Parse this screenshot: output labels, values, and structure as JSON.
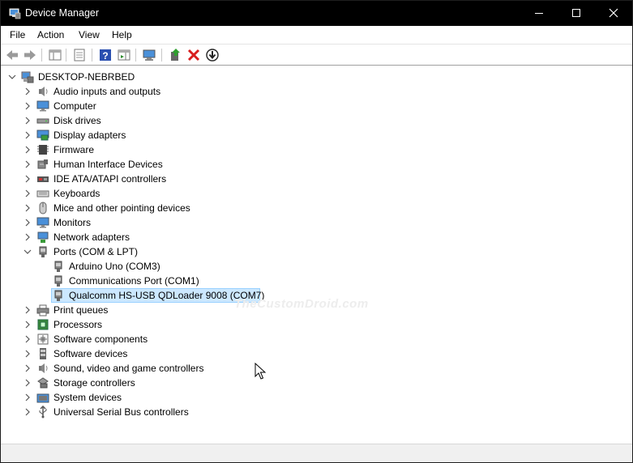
{
  "window": {
    "title": "Device Manager"
  },
  "menu": {
    "file": "File",
    "action": "Action",
    "view": "View",
    "help": "Help"
  },
  "tree": {
    "root": "DESKTOP-NEBRBED",
    "categories": [
      {
        "label": "Audio inputs and outputs",
        "icon": "speaker-icon"
      },
      {
        "label": "Computer",
        "icon": "computer-icon"
      },
      {
        "label": "Disk drives",
        "icon": "disk-drive-icon"
      },
      {
        "label": "Display adapters",
        "icon": "display-adapter-icon"
      },
      {
        "label": "Firmware",
        "icon": "firmware-chip-icon"
      },
      {
        "label": "Human Interface Devices",
        "icon": "hid-icon"
      },
      {
        "label": "IDE ATA/ATAPI controllers",
        "icon": "ide-controller-icon"
      },
      {
        "label": "Keyboards",
        "icon": "keyboard-icon"
      },
      {
        "label": "Mice and other pointing devices",
        "icon": "mouse-icon"
      },
      {
        "label": "Monitors",
        "icon": "monitor-icon"
      },
      {
        "label": "Network adapters",
        "icon": "network-adapter-icon"
      },
      {
        "label": "Ports (COM & LPT)",
        "icon": "port-icon"
      },
      {
        "label": "Print queues",
        "icon": "printer-icon"
      },
      {
        "label": "Processors",
        "icon": "processor-icon"
      },
      {
        "label": "Software components",
        "icon": "software-component-icon"
      },
      {
        "label": "Software devices",
        "icon": "software-device-icon"
      },
      {
        "label": "Sound, video and game controllers",
        "icon": "speaker-icon"
      },
      {
        "label": "Storage controllers",
        "icon": "storage-controller-icon"
      },
      {
        "label": "System devices",
        "icon": "system-device-icon"
      },
      {
        "label": "Universal Serial Bus controllers",
        "icon": "usb-icon"
      }
    ],
    "ports_children": [
      "Arduino Uno (COM3)",
      "Communications Port (COM1)",
      "Qualcomm HS-USB QDLoader 9008 (COM7)"
    ]
  },
  "watermark": "TheCustomDroid.com",
  "colors": {
    "titlebar": "#000000",
    "selection": "#cce8ff",
    "selection_border": "#99d1ff"
  }
}
